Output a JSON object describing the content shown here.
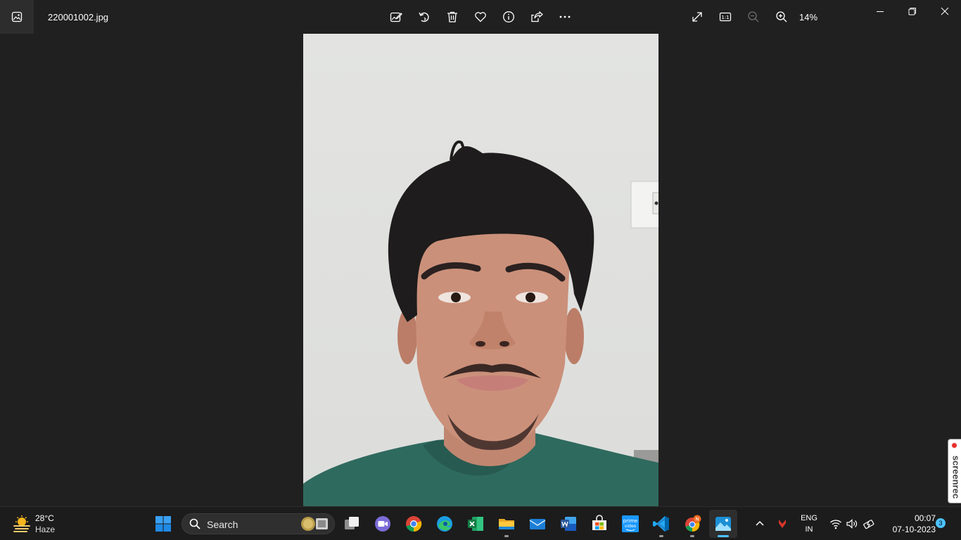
{
  "titlebar": {
    "filename": "220001002.jpg",
    "zoom_level": "14%",
    "tools": [
      "edit-image",
      "rotate",
      "delete",
      "favorite",
      "file-info",
      "share",
      "see-more"
    ],
    "right_tools": [
      "full-screen",
      "actual-size",
      "zoom-out",
      "zoom-in"
    ]
  },
  "screenrec": {
    "label": "screenrec"
  },
  "taskbar": {
    "weather": {
      "temp": "28°C",
      "condition": "Haze"
    },
    "search": {
      "label": "Search"
    },
    "language": {
      "line1": "ENG",
      "line2": "IN"
    },
    "clock": {
      "time": "00:07",
      "date": "07-10-2023"
    },
    "notifications": {
      "count": "3"
    },
    "chrome_badge": "N",
    "apps": [
      "task-view",
      "zoom-meeting",
      "chrome",
      "edge",
      "excel",
      "file-explorer",
      "mail",
      "word",
      "microsoft-store",
      "prime-video",
      "vscode",
      "chrome-profile",
      "photos"
    ]
  }
}
